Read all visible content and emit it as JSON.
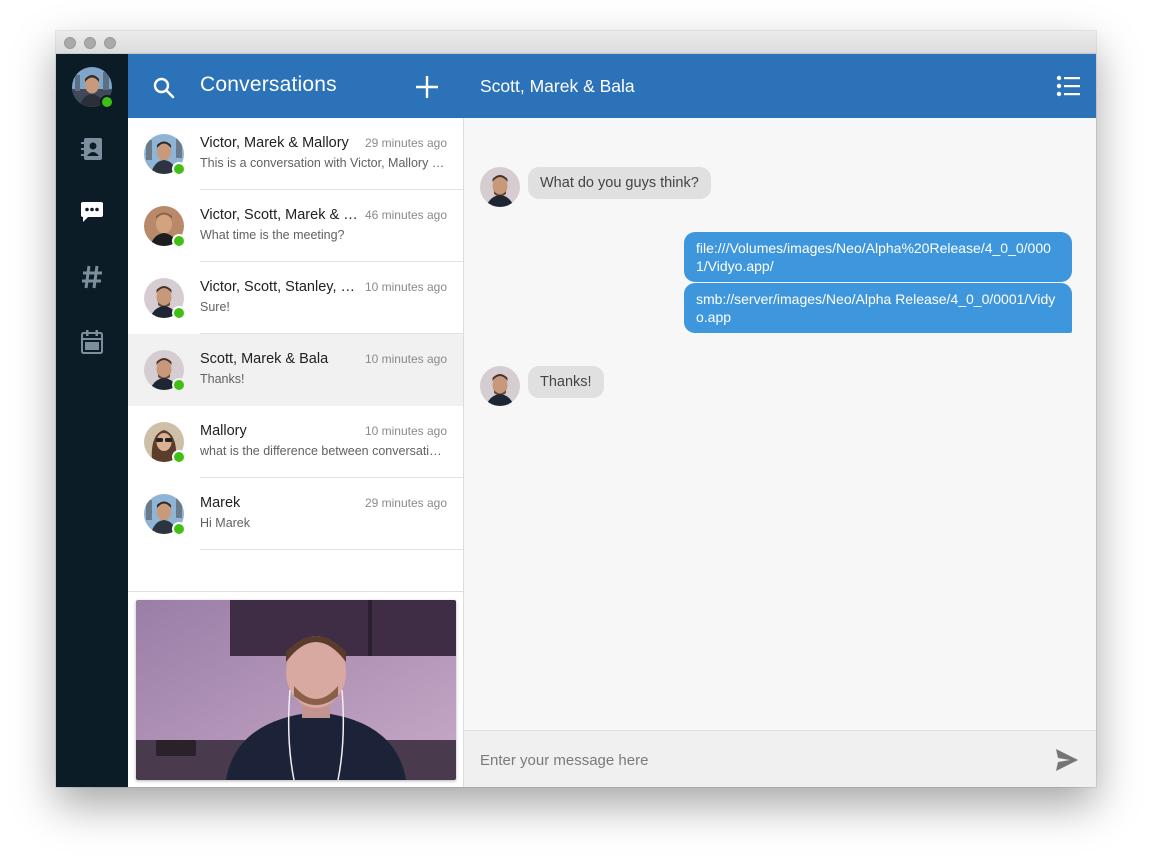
{
  "window": {
    "controls": [
      "close",
      "minimize",
      "maximize"
    ]
  },
  "rail": {
    "user_status": "online",
    "nav": [
      {
        "name": "contacts",
        "icon": "contacts-book-icon"
      },
      {
        "name": "conversations",
        "icon": "chat-bubble-icon",
        "active": true
      },
      {
        "name": "rooms",
        "icon": "hash-icon"
      },
      {
        "name": "calendar",
        "icon": "calendar-icon"
      }
    ]
  },
  "list": {
    "title": "Conversations",
    "search_icon": "search-icon",
    "add_icon": "plus-icon",
    "items": [
      {
        "name": "Victor, Marek & Mallory",
        "time": "29 minutes ago",
        "preview": "This is a conversation with Victor, Mallory and Marek",
        "online": true
      },
      {
        "name": "Victor, Scott, Marek & Bala",
        "time": "46 minutes ago",
        "preview": "What time is the meeting?",
        "online": true
      },
      {
        "name": "Victor, Scott, Stanley, Marek",
        "time": "10 minutes ago",
        "preview": "Sure!",
        "online": true
      },
      {
        "name": "Scott, Marek & Bala",
        "time": "10 minutes ago",
        "preview": "Thanks!",
        "online": true,
        "active": true
      },
      {
        "name": "Mallory",
        "time": "10 minutes ago",
        "preview": "what is the difference between conversations and rooms?",
        "online": true
      },
      {
        "name": "Marek",
        "time": "29 minutes ago",
        "preview": "Hi Marek",
        "online": true
      }
    ]
  },
  "chat": {
    "title": "Scott, Marek & Bala",
    "menu_icon": "list-menu-icon",
    "messages": [
      {
        "direction": "in",
        "text": "What do you guys think?"
      },
      {
        "direction": "out",
        "text": "file:///Volumes/images/Neo/Alpha%20Release/4_0_0/0001/Vidyo.app/"
      },
      {
        "direction": "out",
        "text": "smb://server/images/Neo/Alpha Release/4_0_0/0001/Vidyo.app"
      },
      {
        "direction": "in",
        "text": "Thanks!"
      }
    ],
    "composer": {
      "placeholder": "Enter your message here",
      "send_icon": "send-icon"
    }
  },
  "colors": {
    "header_blue": "#2c72b8",
    "rail_dark": "#0c1c27",
    "bubble_out": "#3e97dd",
    "bubble_in": "#e0e0e0",
    "presence_green": "#3fc012"
  }
}
